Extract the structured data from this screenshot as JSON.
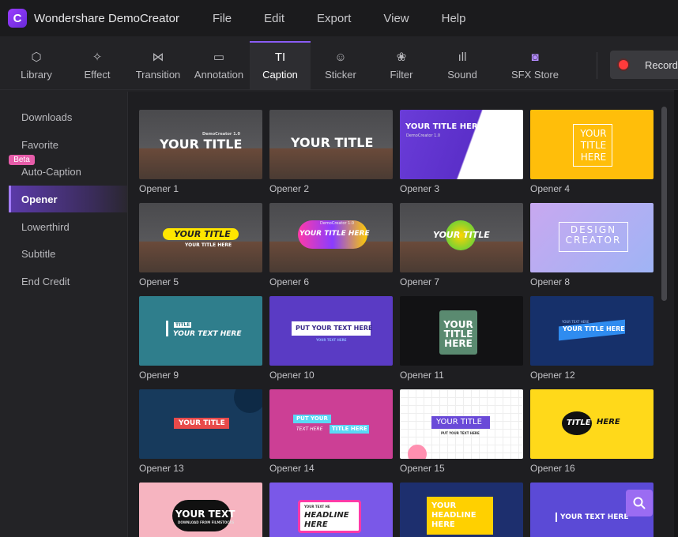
{
  "app": {
    "title": "Wondershare DemoCreator",
    "logo_letter": "C"
  },
  "menu": [
    "File",
    "Edit",
    "Export",
    "View",
    "Help"
  ],
  "toolbar": {
    "tools": [
      {
        "label": "Library",
        "icon": "cube-icon",
        "glyph": "⬡"
      },
      {
        "label": "Effect",
        "icon": "magic-wand-icon",
        "glyph": "✧"
      },
      {
        "label": "Transition",
        "icon": "transition-icon",
        "glyph": "⋈"
      },
      {
        "label": "Annotation",
        "icon": "annotation-icon",
        "glyph": "▭"
      },
      {
        "label": "Caption",
        "icon": "caption-text-icon",
        "glyph": "TI"
      },
      {
        "label": "Sticker",
        "icon": "smiley-icon",
        "glyph": "☺"
      },
      {
        "label": "Filter",
        "icon": "filter-circles-icon",
        "glyph": "❀"
      },
      {
        "label": "Sound",
        "icon": "soundwave-icon",
        "glyph": "ıll"
      },
      {
        "label": "SFX Store",
        "icon": "store-icon",
        "glyph": "◙"
      }
    ],
    "active": "Caption",
    "record_label": "Record"
  },
  "sidebar": {
    "items": [
      "Downloads",
      "Favorite",
      "Auto-Caption",
      "Opener",
      "Lowerthird",
      "Subtitle",
      "End Credit"
    ],
    "active": "Opener",
    "beta_label": "Beta"
  },
  "grid": {
    "cards": [
      {
        "name": "Opener 1",
        "text": "YOUR TITLE",
        "sub": "DemoCreator 1.0"
      },
      {
        "name": "Opener 2",
        "text": "YOUR TITLE"
      },
      {
        "name": "Opener 3",
        "text": "YOUR TITLE HERE",
        "sub": "DemoCreator 1.0"
      },
      {
        "name": "Opener 4",
        "text": "YOUR TITLE HERE"
      },
      {
        "name": "Opener 5",
        "text": "YOUR TITLE",
        "sub": "YOUR TITLE HERE"
      },
      {
        "name": "Opener 6",
        "text": "YOUR TITLE HERE",
        "sub": "DemoCreator 1.0"
      },
      {
        "name": "Opener 7",
        "text": "YOUR TITLE"
      },
      {
        "name": "Opener 8",
        "text": "DESIGN CREATOR"
      },
      {
        "name": "Opener 9",
        "text": "YOUR TEXT HERE",
        "sub": "TITLE"
      },
      {
        "name": "Opener 10",
        "text": "PUT YOUR TEXT HERE",
        "sub": "YOUR TEXT HERE"
      },
      {
        "name": "Opener 11",
        "text": "YOUR TITLE HERE"
      },
      {
        "name": "Opener 12",
        "text": "YOUR TITLE HERE",
        "sub": "YOUR TEXT HERE"
      },
      {
        "name": "Opener 13",
        "text": "YOUR TITLE"
      },
      {
        "name": "Opener 14",
        "text": "PUT YOUR",
        "sub": "TEXT HERE",
        "sub2": "TITLE HERE"
      },
      {
        "name": "Opener 15",
        "text": "YOUR TITLE",
        "sub": "PUT YOUR TEXT HERE"
      },
      {
        "name": "Opener 16",
        "text": "TITLE",
        "sub": "HERE"
      },
      {
        "name": "",
        "text": "YOUR TEXT",
        "sub": "DOWNLOAD FROM FILMSTOCKS"
      },
      {
        "name": "",
        "text": "HEADLINE HERE",
        "sub": "YOUR TEXT HE"
      },
      {
        "name": "",
        "text": "YOUR HEADLINE HERE"
      },
      {
        "name": "",
        "text": "YOUR TEXT HERE"
      }
    ]
  },
  "colors": {
    "accent": "#8a5cf6",
    "record": "#ff3b3b",
    "beta": "#e65ca9"
  }
}
